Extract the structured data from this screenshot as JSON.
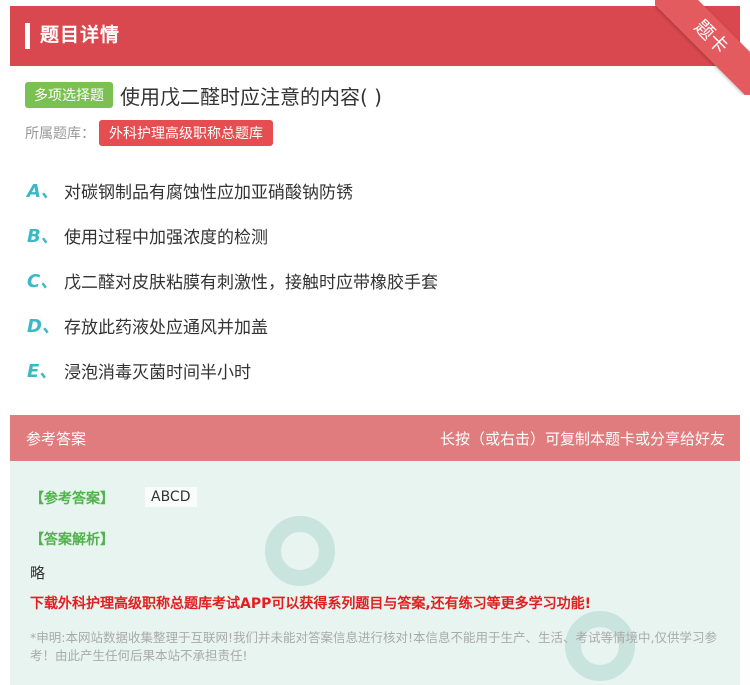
{
  "header": {
    "title": "题目详情",
    "corner_label": "题卡"
  },
  "question": {
    "type_tag": "多项选择题",
    "text": "使用戊二醛时应注意的内容( )",
    "bank_label": "所属题库：",
    "bank_tag": "外科护理高级职称总题库"
  },
  "options": [
    {
      "letter": "A、",
      "text": "对碳钢制品有腐蚀性应加亚硝酸钠防锈"
    },
    {
      "letter": "B、",
      "text": "使用过程中加强浓度的检测"
    },
    {
      "letter": "C、",
      "text": "戊二醛对皮肤粘膜有刺激性，接触时应带橡胶手套"
    },
    {
      "letter": "D、",
      "text": "存放此药液处应通风并加盖"
    },
    {
      "letter": "E、",
      "text": "浸泡消毒灭菌时间半小时"
    }
  ],
  "answer": {
    "section_title": "参考答案",
    "copy_hint": "长按（或右击）可复制本题卡或分享给好友",
    "answer_label": "【参考答案】",
    "answer_value": "ABCD",
    "analysis_label": "【答案解析】",
    "analysis_text": "略",
    "promo": "下载外科护理高级职称总题库考试APP可以获得系列题目与答案,还有练习等更多学习功能!",
    "disclaimer": "*申明:本网站数据收集整理于互联网!我们并未能对答案信息进行核对!本信息不能用于生产、生活、考试等情境中,仅供学习参考！由此产生任何后果本站不承担责任!"
  },
  "colors": {
    "header": "#d9484e",
    "option_letter": "#3ab8c4",
    "answer_bg": "#e8f4f0",
    "promo": "#e02020"
  }
}
